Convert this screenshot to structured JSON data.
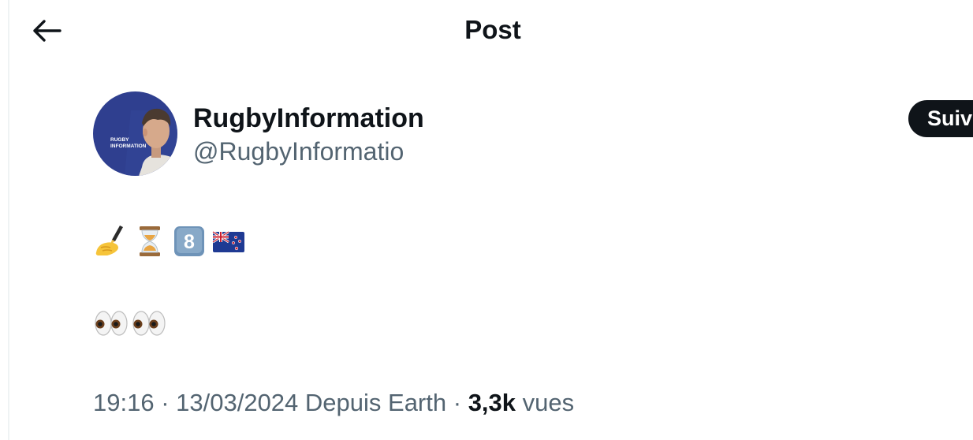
{
  "header": {
    "title": "Post",
    "back_icon": "arrow-left-icon"
  },
  "author": {
    "name": "RugbyInformation",
    "handle": "@RugbyInformatio",
    "avatar_text_line1": "RUGBY",
    "avatar_text_line2": "INFORMATION"
  },
  "follow_button": {
    "label": "Suivre"
  },
  "tweet": {
    "line1_emojis": [
      "writing-hand-icon",
      "hourglass-icon",
      "keycap-8-icon",
      "new-zealand-flag-icon"
    ],
    "line2_emojis": [
      "eyes-icon",
      "eyes-icon"
    ]
  },
  "meta": {
    "time": "19:16",
    "separator1": " · ",
    "date": "13/03/2024",
    "source": " Depuis Earth",
    "separator2": " · ",
    "views_count": "3,3k",
    "views_label": " vues"
  },
  "colors": {
    "text_primary": "#0f1419",
    "text_secondary": "#536471",
    "avatar_bg": "#2f3f8f",
    "button_bg": "#0f1419"
  }
}
